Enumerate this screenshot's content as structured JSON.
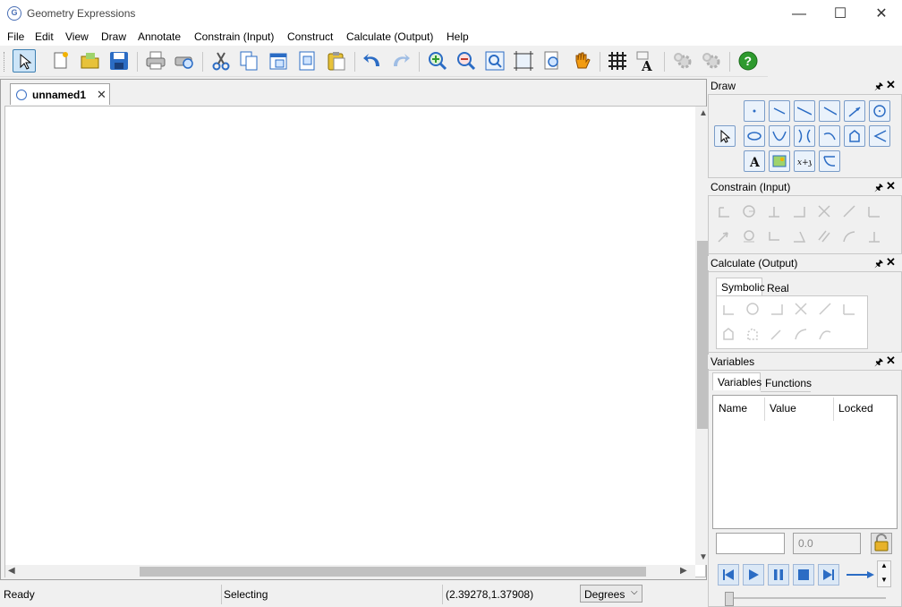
{
  "window": {
    "title": "Geometry Expressions",
    "minimize_glyph": "—",
    "maximize_glyph": "☐",
    "close_glyph": "✕"
  },
  "menu": [
    "File",
    "Edit",
    "View",
    "Draw",
    "Annotate",
    "Constrain (Input)",
    "Construct",
    "Calculate (Output)",
    "Help"
  ],
  "toolbar_icons": [
    "select-arrow-icon",
    "new-file-icon",
    "open-folder-icon",
    "save-disk-icon",
    "print-icon",
    "print-preview-icon",
    "cut-scissors-icon",
    "copy-icon",
    "paste-special-icon",
    "paste-special-2-icon",
    "paste-clipboard-icon",
    "undo-icon",
    "redo-icon",
    "zoom-in-icon",
    "zoom-out-icon",
    "zoom-window-icon",
    "zoom-fit-icon",
    "zoom-page-icon",
    "pan-hand-icon",
    "grid-icon",
    "font-settings-icon",
    "gear-disabled-icon",
    "gear-2-disabled-icon",
    "help-icon"
  ],
  "document": {
    "tab_label": "unnamed1",
    "tab_close": "✕"
  },
  "status": {
    "ready": "Ready",
    "mode": "Selecting",
    "coords": "(2.39278,1.37908)",
    "angle_unit": "Degrees"
  },
  "panels": {
    "draw": {
      "title": "Draw"
    },
    "constrain": {
      "title": "Constrain (Input)"
    },
    "calculate": {
      "title": "Calculate (Output)",
      "tabs": [
        "Symbolic",
        "Real"
      ]
    },
    "variables": {
      "title": "Variables",
      "tabs": [
        "Variables",
        "Functions"
      ],
      "columns": [
        "Name",
        "Value",
        "Locked"
      ],
      "name_input": "",
      "value_input": "0.0"
    },
    "pin_glyph": "🖈",
    "close_glyph": "✕"
  },
  "colors": {
    "accent_blue": "#2b6cc4",
    "help_green": "#2e9a2e"
  }
}
